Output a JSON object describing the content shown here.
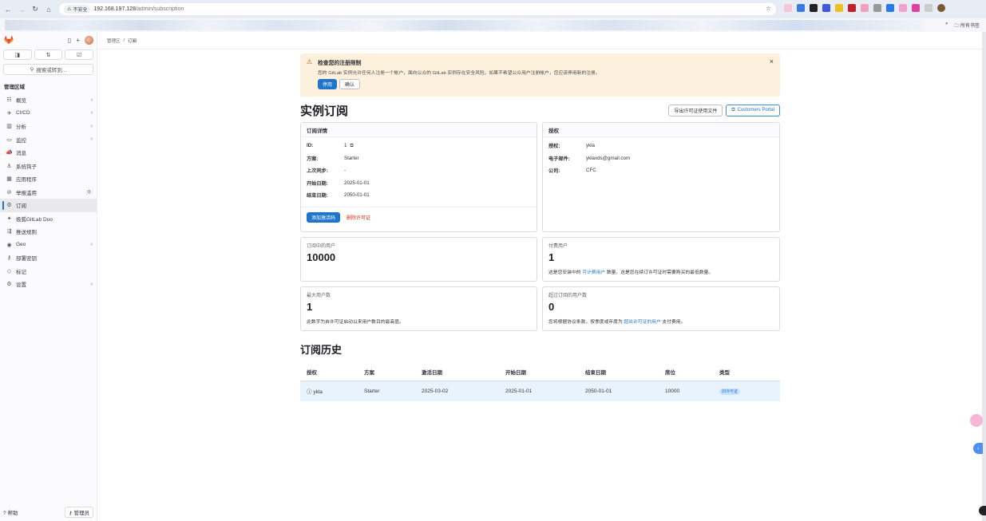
{
  "browser": {
    "insecure_label": "不安全",
    "url_host": "192.168.197.128",
    "url_path": "/admin/subscription",
    "bookmarks_all": "所有书签"
  },
  "sidebar": {
    "search_label": "搜索或转到...",
    "section_title": "管理区域",
    "items": [
      {
        "label": "概览",
        "icon": "overview-icon",
        "chev": true
      },
      {
        "label": "CI/CD",
        "icon": "rocket-icon",
        "chev": true
      },
      {
        "label": "分析",
        "icon": "chart-icon",
        "chev": true
      },
      {
        "label": "监控",
        "icon": "monitor-icon",
        "chev": true
      },
      {
        "label": "消息",
        "icon": "bullhorn-icon"
      },
      {
        "label": "系统钩子",
        "icon": "anchor-icon"
      },
      {
        "label": "应用程序",
        "icon": "apps-icon"
      },
      {
        "label": "举报滥用",
        "icon": "abuse-icon",
        "count": "0"
      },
      {
        "label": "订阅",
        "icon": "subscription-icon",
        "active": true
      },
      {
        "label": "极狐GitLab Duo",
        "icon": "duo-icon"
      },
      {
        "label": "推送规则",
        "icon": "push-rules-icon"
      },
      {
        "label": "Geo",
        "icon": "geo-icon",
        "chev": true
      },
      {
        "label": "部署密钥",
        "icon": "key-icon"
      },
      {
        "label": "标记",
        "icon": "label-icon"
      },
      {
        "label": "设置",
        "icon": "settings-icon",
        "chev": true
      }
    ],
    "help_label": "帮助",
    "admin_label": "管理员"
  },
  "breadcrumb": {
    "parent": "管理区",
    "current": "订阅"
  },
  "alert": {
    "title": "检查您的注册限制",
    "body": "您的 GitLab 实例允许任何人注册一个帐户，面向公众的 GitLab 实例存在安全风险。如果不希望公众用户注册帐户，您应该停用新的注册。",
    "primary": "停用",
    "secondary": "确认"
  },
  "page_title": "实例订阅",
  "actions": {
    "export": "导出许可证使用文件",
    "portal": "Customers Portal"
  },
  "subscription_details": {
    "header": "订阅详情",
    "rows": [
      {
        "k": "ID:",
        "v": "1"
      },
      {
        "k": "方案:",
        "v": "Starter"
      },
      {
        "k": "上次同步:",
        "v": "-"
      },
      {
        "k": "开始日期:",
        "v": "2025-01-01"
      },
      {
        "k": "结束日期:",
        "v": "2050-01-01"
      }
    ],
    "add_code": "添加激活码",
    "remove_license": "删除许可证"
  },
  "licensee": {
    "header": "授权",
    "rows": [
      {
        "k": "授权:",
        "v": "ykla"
      },
      {
        "k": "电子邮件:",
        "v": "yklaxds@gmail.com"
      },
      {
        "k": "公司:",
        "v": "CFC"
      }
    ]
  },
  "stats": {
    "users_in_sub": {
      "label": "订阅中的用户",
      "value": "10000"
    },
    "billable": {
      "label": "付费用户",
      "value": "1",
      "desc_pre": "这是您安装中的 ",
      "desc_link": "可计费用户",
      "desc_post": " 数量，这是您在续订许可证时需要购买的最低数量。"
    },
    "max_users": {
      "label": "最大用户数",
      "value": "1",
      "desc": "此数字为自许可证启动以来用户数目的最高值。"
    },
    "overage": {
      "label": "超过订阅的用户数",
      "value": "0",
      "desc_pre": "您将根据协议条款，按季度或年度为 ",
      "desc_link": "超出许可证的用户",
      "desc_post": " 支付费用。"
    }
  },
  "history": {
    "title": "订阅历史",
    "columns": [
      "授权",
      "方案",
      "激活日期",
      "开始日期",
      "结束日期",
      "席位",
      "类型"
    ],
    "row": {
      "licensee": "ykla",
      "plan": "Starter",
      "activated": "2025-03-02",
      "start": "2025-01-01",
      "end": "2050-01-01",
      "seats": "10000",
      "type": "旧许可证"
    }
  }
}
